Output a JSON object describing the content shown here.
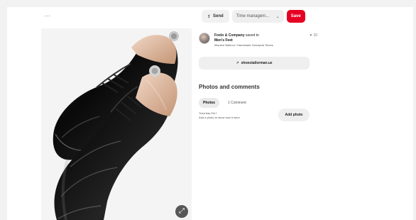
{
  "top": {
    "more_label": "···"
  },
  "toolbar": {
    "send_label": "Send",
    "board_label": "Time managem...",
    "save_label": "Save"
  },
  "pin": {
    "saver_name": "Foelo & Company",
    "saved_to": "saved to",
    "board_name": "Men's Feet",
    "description": "Maurice Balboui / Handmade Goodyear Shoes",
    "reaction_count": "10",
    "source_label": "shoestailorman.uz"
  },
  "comments": {
    "title": "Photos and comments",
    "tabs": [
      "Photos",
      "1 Comment"
    ],
    "prompt_title": "Tried this Pin?",
    "prompt_text": "Add a photo to show how it went",
    "add_photo_label": "Add photo"
  },
  "icons": {
    "more": "more-options-icon",
    "send": "share-icon",
    "dropdown": "chevron-down-icon",
    "reaction": "heart-icon",
    "link": "link-icon",
    "expand": "expand-icon"
  },
  "colors": {
    "accent": "#e60023",
    "background": "#ffffff",
    "button": "#efefef"
  }
}
